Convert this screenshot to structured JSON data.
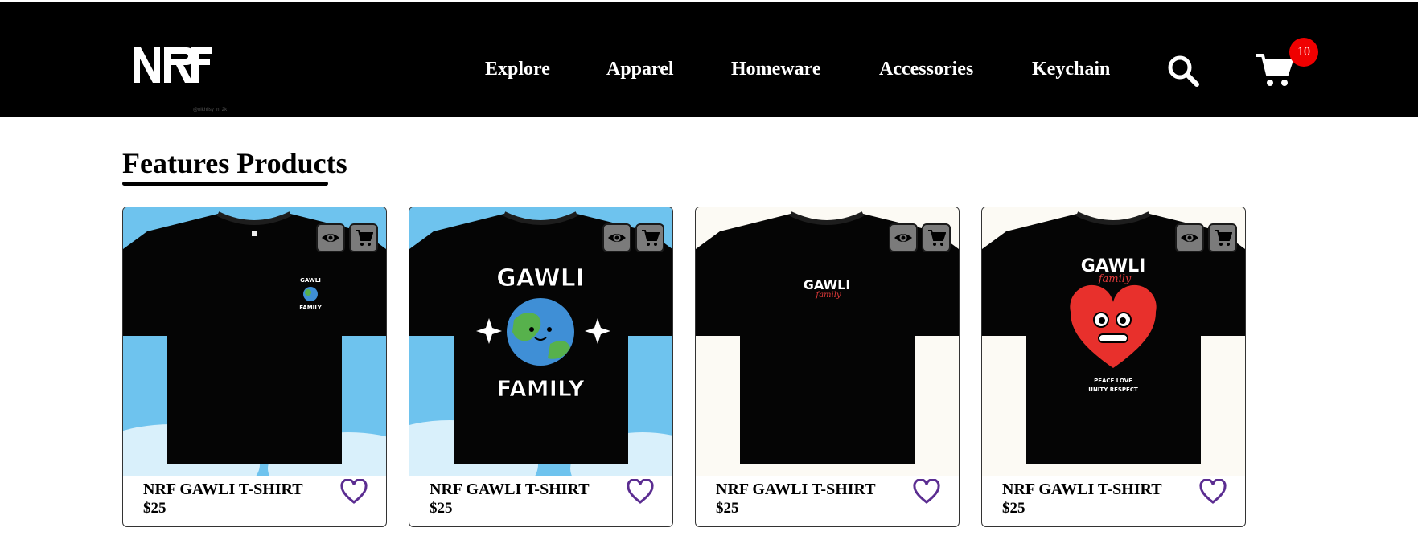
{
  "header": {
    "logo_text": "NRF",
    "logo_caption": "@nikhilsy_n_2k",
    "nav": [
      {
        "label": "Explore"
      },
      {
        "label": "Apparel"
      },
      {
        "label": "Homeware"
      },
      {
        "label": "Accessories"
      },
      {
        "label": "Keychain"
      }
    ],
    "search_icon": "search-icon",
    "cart_icon": "cart-icon",
    "cart_count": "10",
    "badge_color": "#f00000"
  },
  "main": {
    "section_title": "Features Products",
    "products": [
      {
        "name": "NRF GAWLI T-SHIRT",
        "price": "$25",
        "print": "small chest logo: GAWLI FAMILY with globe",
        "background": "sky"
      },
      {
        "name": "NRF GAWLI T-SHIRT",
        "price": "$25",
        "print": "large GAWLI FAMILY globe with sparkles",
        "background": "sky",
        "print_top": "GAWLI",
        "print_bottom": "FAMILY"
      },
      {
        "name": "NRF GAWLI T-SHIRT",
        "price": "$25",
        "print": "GAWLI family text",
        "background": "cream",
        "print_top": "GAWLI",
        "print_script": "family"
      },
      {
        "name": "NRF GAWLI T-SHIRT",
        "price": "$25",
        "print": "GAWLI family heart character",
        "background": "cream",
        "print_top": "GAWLI",
        "print_script": "family",
        "print_line1": "PEACE LOVE",
        "print_line2": "UNITY RESPECT"
      }
    ],
    "icons": {
      "view": "eye-icon",
      "add_to_cart": "cart-icon",
      "wishlist": "heart-icon"
    },
    "colors": {
      "heart": "#5b2d91",
      "icon_button_bg": "#7b7b7b",
      "sky": "#6ec3ee",
      "cream": "#fcfaf4"
    }
  }
}
